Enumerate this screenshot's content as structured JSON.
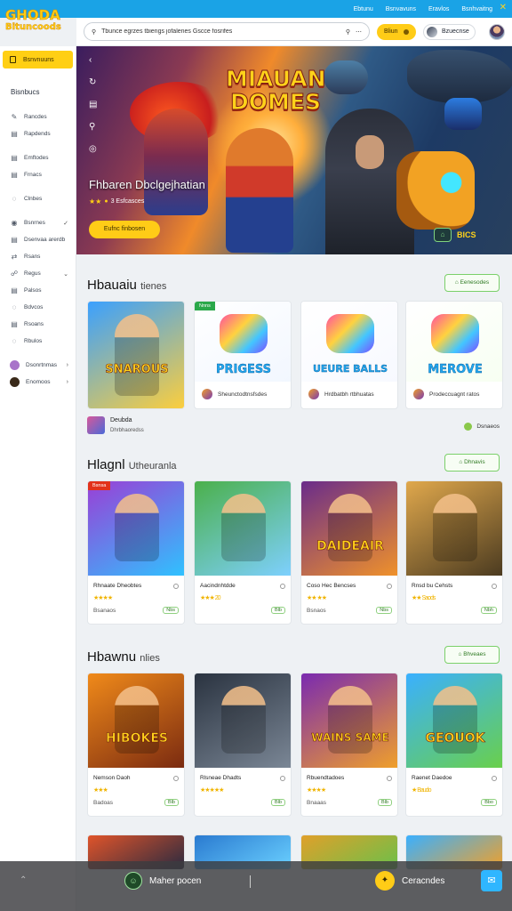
{
  "topbar": {
    "links": [
      "Ebtunu",
      "Bsnvavuns",
      "Eravlos",
      "Bsnhvaitng"
    ],
    "close_icon": "close-icon"
  },
  "logo": {
    "line1": "GHODA",
    "line2": "Bituncoods"
  },
  "header": {
    "search_text": "Tbunce egrzes tbiengs jofalenes Gscce fosrifes",
    "action_label": "Bliun",
    "user_label": "Bzuecnse"
  },
  "sidebar": {
    "home_label": "Bsnvnuuns",
    "heading": "Bisnbucs",
    "groups": [
      [
        {
          "icon": "✎",
          "label": "Rancdes"
        },
        {
          "icon": "▤",
          "label": "Rapdends"
        }
      ],
      [
        {
          "icon": "▤",
          "label": "Emftodes"
        },
        {
          "icon": "▤",
          "label": "Frnacs"
        }
      ],
      [
        {
          "icon": "◌",
          "label": "Clnbes"
        }
      ],
      [
        {
          "icon": "◉",
          "label": "Bsnrnes",
          "chev": "✓"
        },
        {
          "icon": "▤",
          "label": "Dsenvaa arerdb"
        },
        {
          "icon": "⇄",
          "label": "Rsans"
        },
        {
          "icon": "☍",
          "label": "Regus",
          "chev": "⌄"
        },
        {
          "icon": "▤",
          "label": "Palsos"
        },
        {
          "icon": "◌",
          "label": "Bdvcos"
        },
        {
          "icon": "▤",
          "label": "Rsoans"
        },
        {
          "icon": "◌",
          "label": "Rbulos"
        }
      ],
      [
        {
          "avatar": "#a874c9",
          "label": "Dsonrtnmas",
          "chev": "›"
        },
        {
          "avatar": "#3a2a1a",
          "label": "Enomoos",
          "chev": "›"
        }
      ]
    ]
  },
  "hero": {
    "title": "MIAUAN DOMES",
    "subtitle": "Fhbaren Dbclgejhatian",
    "rating_suffix": "3 Esfcasces",
    "play_label": "Eufnc finbosen",
    "ctrl_icon": "gamepad-icon",
    "ctrl_label": "BICS",
    "rail_icons": [
      "‹",
      "↻",
      "▤",
      "⚲",
      "◎"
    ]
  },
  "sections": [
    {
      "title": "Hbauaiu",
      "title_small": "tienes",
      "button": "Eenesodes",
      "featured": {
        "name": "Deubda",
        "sub": "Dhrbhaoredss"
      },
      "more_label": "Dsnaeos",
      "cards": [
        {
          "art": "SNAROUS",
          "art_sub": "",
          "colors": [
            "#3aa0ff",
            "#ffcf3a"
          ],
          "name": "",
          "meta": ""
        },
        {
          "art": "PRIGESS",
          "badge": "Nnns",
          "colors": [
            "#ffffff",
            "#f2f7ff"
          ],
          "name": "Sheunctodtnsfsdes",
          "meta": ""
        },
        {
          "art": "UEURE BALLS",
          "colors": [
            "#ffffff",
            "#f7f9ff"
          ],
          "name": "Hrdbatbh rtbhuatas",
          "meta": ""
        },
        {
          "art": "MEROVE",
          "colors": [
            "#ffffff",
            "#f7fff2"
          ],
          "name": "Prodeccuagnt ratos",
          "meta": ""
        }
      ]
    },
    {
      "title": "Hlagnl",
      "title_small": "Utheuranla",
      "button": "Dhnavis",
      "cards": [
        {
          "art": "",
          "badge": "Bsnsa",
          "colors": [
            "#9a3fd6",
            "#2fc2ff"
          ],
          "name": "Rhnaate Dheobtes",
          "rating": "★★★★",
          "meta": "Bsanaos",
          "pill": "Nbs"
        },
        {
          "art": "",
          "colors": [
            "#4bb04b",
            "#7ed0ff"
          ],
          "name": "Aacindnhtdde",
          "rating": "★★★ 20",
          "meta": "",
          "pill": "Blb"
        },
        {
          "art": "DAIDEAIR",
          "colors": [
            "#6a2c8a",
            "#f0922a"
          ],
          "name": "Coso Hec Bencses",
          "rating": "★★ ★★",
          "meta": "Bsnaos",
          "pill": "Nbs"
        },
        {
          "art": "",
          "colors": [
            "#e0a84c",
            "#4a3a20"
          ],
          "name": "Rnsd bu Cehsts",
          "rating": "★★ Saods",
          "meta": "",
          "pill": "Nbh"
        }
      ]
    },
    {
      "title": "Hbawnu",
      "title_small": "nlies",
      "button": "Bhveaes",
      "cards": [
        {
          "art": "HIBOKES",
          "colors": [
            "#f08a1a",
            "#7a2a10"
          ],
          "name": "Nemson Daoh",
          "rating": "★★★",
          "meta": "Badoas",
          "pill": "Blb"
        },
        {
          "art": "",
          "colors": [
            "#2a3340",
            "#7b8796"
          ],
          "name": "Rlsneae Dhadts",
          "rating": "★★★★★",
          "meta": "",
          "pill": "Blb"
        },
        {
          "art": "WAINS SAME",
          "colors": [
            "#7a2ab0",
            "#f0a02a"
          ],
          "name": "Rbuendtadoes",
          "rating": "★★★★",
          "meta": "Bnaaas",
          "pill": "Blb"
        },
        {
          "art": "GEOUOK",
          "colors": [
            "#3ab0ff",
            "#6ad04a"
          ],
          "name": "Raenet Daedoe",
          "rating": "★ Baudo",
          "meta": "",
          "pill": "Bbo"
        }
      ]
    }
  ],
  "bottom": {
    "left_label": "Maher pocen",
    "right_label": "Ceracndes"
  }
}
